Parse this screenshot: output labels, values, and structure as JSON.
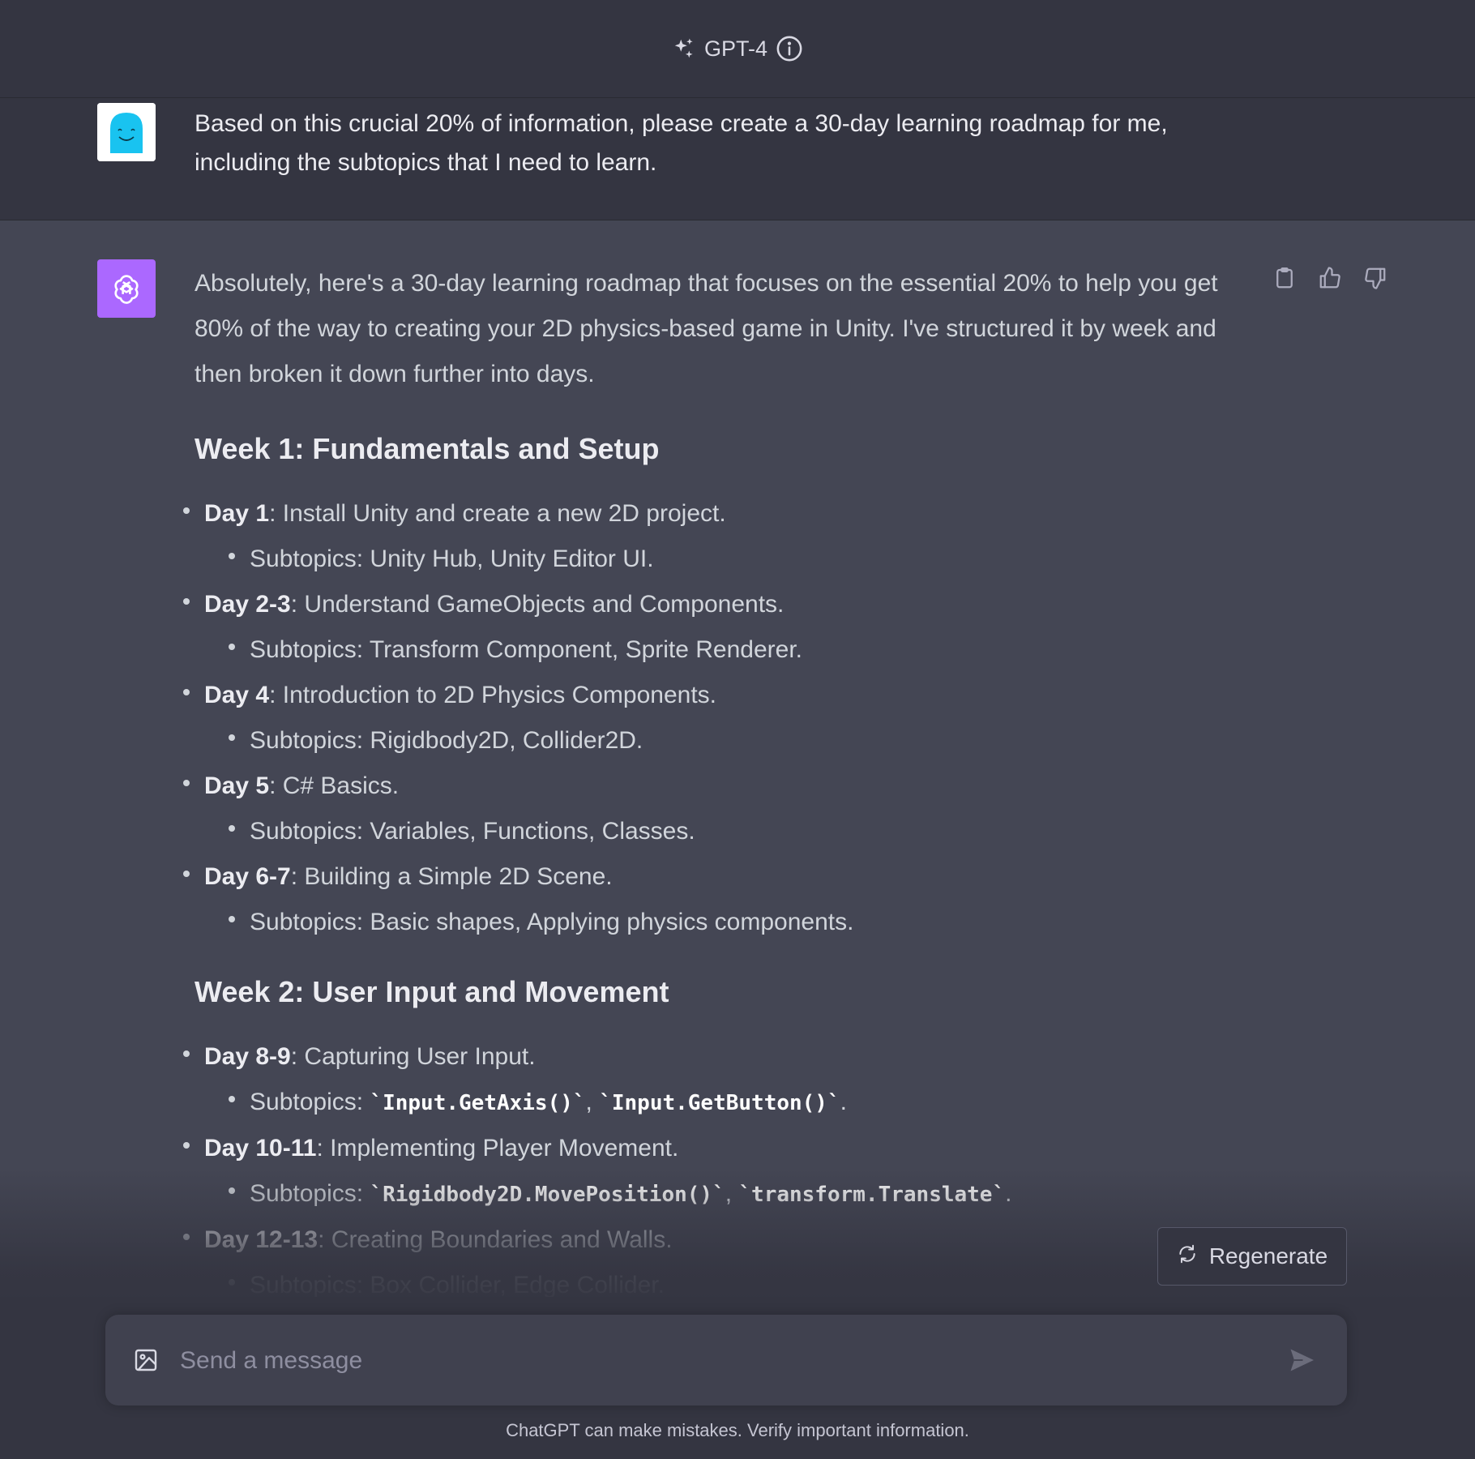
{
  "header": {
    "model_name": "GPT-4",
    "sparkle_icon": "sparkle-icon",
    "info_icon": "info-icon"
  },
  "user_message": {
    "text": "Based on this crucial 20% of information, please create a 30-day learning roadmap for me, including the subtopics that I need to learn."
  },
  "assistant_message": {
    "intro": "Absolutely, here's a 30-day learning roadmap that focuses on the essential 20% to help you get 80% of the way to creating your 2D physics-based game in Unity. I've structured it by week and then broken it down further into days.",
    "weeks": [
      {
        "title": "Week 1: Fundamentals and Setup",
        "days": [
          {
            "label": "Day 1",
            "text": ": Install Unity and create a new 2D project.",
            "sub_prefix": "Subtopics: ",
            "sub": "Unity Hub, Unity Editor UI."
          },
          {
            "label": "Day 2-3",
            "text": ": Understand GameObjects and Components.",
            "sub_prefix": "Subtopics: ",
            "sub": "Transform Component, Sprite Renderer."
          },
          {
            "label": "Day 4",
            "text": ": Introduction to 2D Physics Components.",
            "sub_prefix": "Subtopics: ",
            "sub": "Rigidbody2D, Collider2D."
          },
          {
            "label": "Day 5",
            "text": ": C# Basics.",
            "sub_prefix": "Subtopics: ",
            "sub": "Variables, Functions, Classes."
          },
          {
            "label": "Day 6-7",
            "text": ": Building a Simple 2D Scene.",
            "sub_prefix": "Subtopics: ",
            "sub": "Basic shapes, Applying physics components."
          }
        ]
      },
      {
        "title": "Week 2: User Input and Movement",
        "days": [
          {
            "label": "Day 8-9",
            "text": ": Capturing User Input.",
            "sub_prefix": "Subtopics: ",
            "code1": "`Input.GetAxis()`",
            "sep": ", ",
            "code2": "`Input.GetButton()`",
            "end": "."
          },
          {
            "label": "Day 10-11",
            "text": ": Implementing Player Movement.",
            "sub_prefix": "Subtopics: ",
            "code1": "`Rigidbody2D.MovePosition()`",
            "sep": ", ",
            "code2": "`transform.Translate`",
            "end": "."
          },
          {
            "label": "Day 12-13",
            "text": ": Creating Boundaries and Walls.",
            "sub_prefix": "Subtopics: ",
            "sub": "Box Collider, Edge Collider."
          }
        ]
      }
    ],
    "actions": [
      "copy-icon",
      "thumbs-up-icon",
      "thumbs-down-icon"
    ]
  },
  "regenerate": {
    "label": "Regenerate",
    "icon": "refresh-icon"
  },
  "composer": {
    "placeholder": "Send a message",
    "image_icon": "image-icon",
    "send_icon": "send-icon"
  },
  "footer": {
    "note": "ChatGPT can make mistakes. Verify important information."
  },
  "colors": {
    "assistant_bg": "#444654",
    "user_bg": "#343541",
    "gpt_avatar": "#ab68ff",
    "user_avatar_face": "#19c3f0"
  }
}
